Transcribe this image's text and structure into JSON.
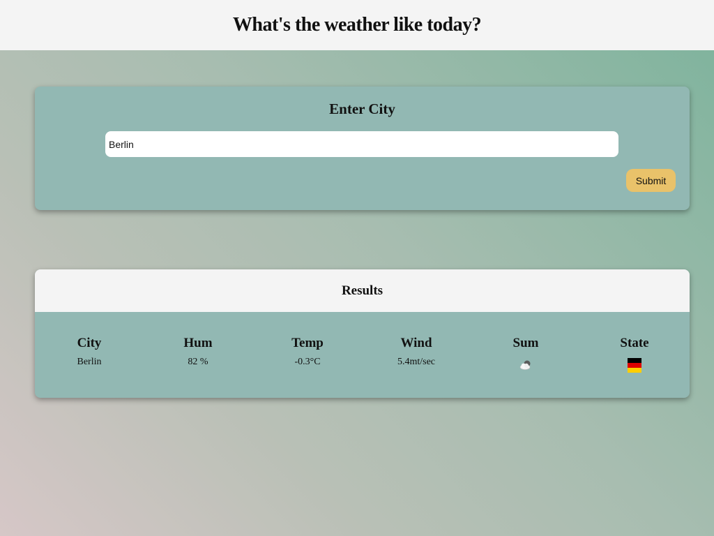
{
  "header": {
    "title": "What's the weather like today?"
  },
  "search": {
    "title": "Enter City",
    "value": "Berlin",
    "placeholder": "",
    "submit_label": "Submit"
  },
  "results": {
    "title": "Results",
    "columns": [
      {
        "header": "City",
        "value": "Berlin"
      },
      {
        "header": "Hum",
        "value": "82 %"
      },
      {
        "header": "Temp",
        "value": "-0.3°C"
      },
      {
        "header": "Wind",
        "value": "5.4mt/sec"
      },
      {
        "header": "Sum",
        "icon": "partly-cloudy-icon"
      },
      {
        "header": "State",
        "icon": "germany-flag-icon"
      }
    ]
  },
  "colors": {
    "header_bg": "#f4f4f4",
    "card_bg": "#92b8b3",
    "submit_bg": "#e9c26a",
    "flag": [
      "#000000",
      "#dd0000",
      "#ffce00"
    ]
  }
}
